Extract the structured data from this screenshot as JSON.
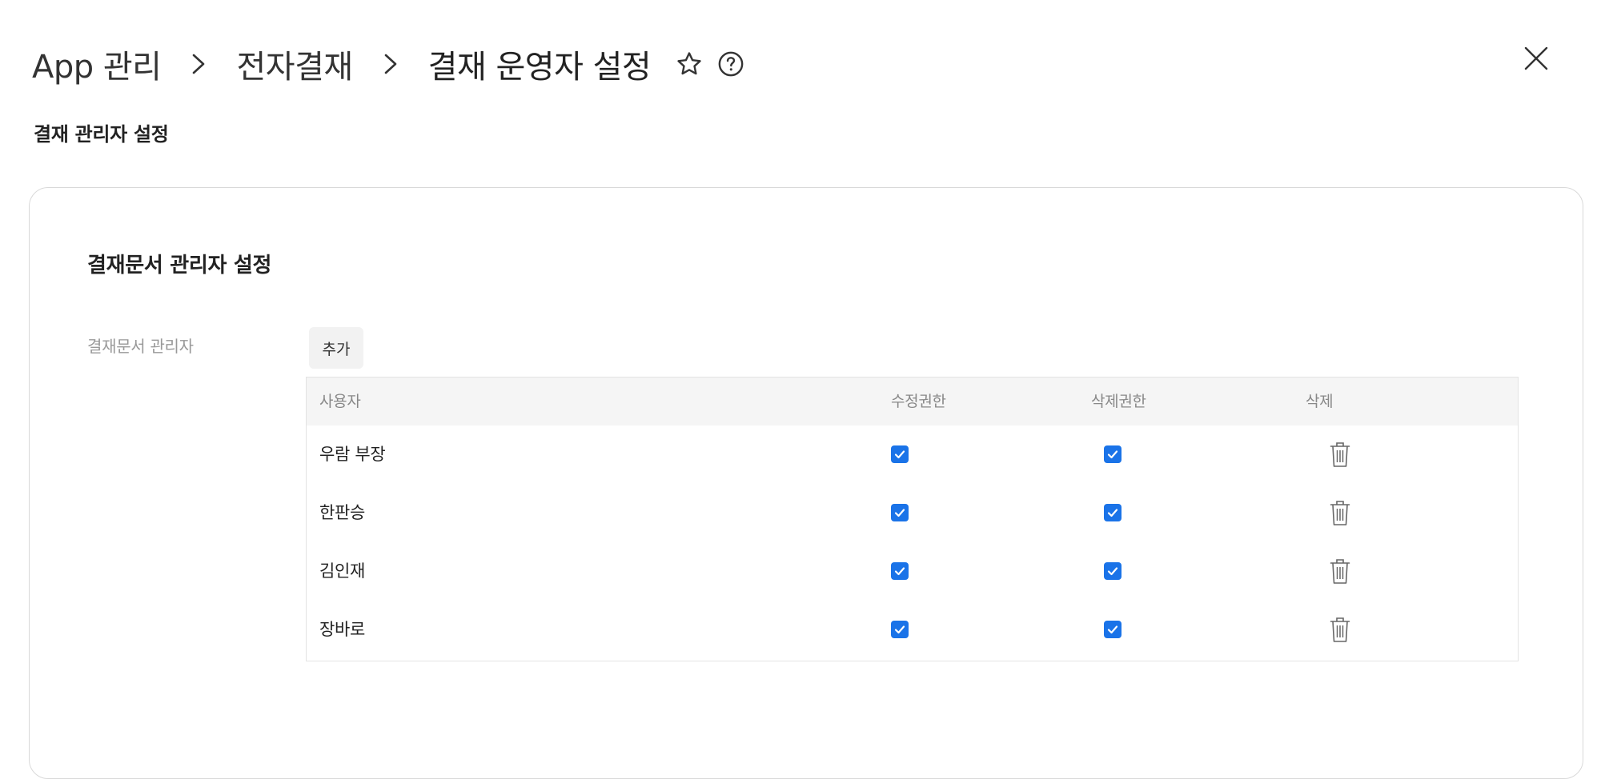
{
  "breadcrumb": {
    "items": [
      "App 관리",
      "전자결재"
    ],
    "current": "결재 운영자 설정"
  },
  "icons": {
    "favorite": "star-outline-icon",
    "help": "question-circle-icon",
    "close": "close-icon",
    "separator": "chevron-right-icon",
    "delete": "trash-icon",
    "check": "checkmark-icon"
  },
  "section": {
    "title": "결재 관리자 설정"
  },
  "card": {
    "title": "결재문서 관리자 설정",
    "field_label": "결재문서 관리자",
    "add_label": "추가"
  },
  "table": {
    "headers": {
      "user": "사용자",
      "edit": "수정권한",
      "delete_perm": "삭제권한",
      "delete": "삭제"
    },
    "rows": [
      {
        "name": "우람 부장",
        "edit": true,
        "delete_perm": true
      },
      {
        "name": "한판승",
        "edit": true,
        "delete_perm": true
      },
      {
        "name": "김인재",
        "edit": true,
        "delete_perm": true
      },
      {
        "name": "장바로",
        "edit": true,
        "delete_perm": true
      }
    ]
  },
  "colors": {
    "accent": "#1a73e8",
    "header_bg": "#f5f5f5",
    "border": "#d9d9d9",
    "muted_text": "#999999"
  }
}
